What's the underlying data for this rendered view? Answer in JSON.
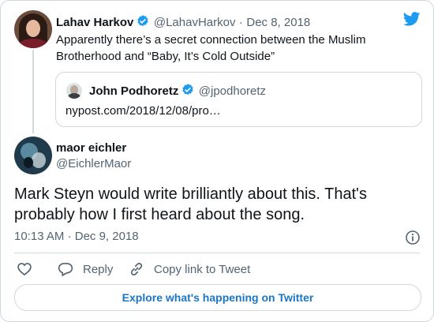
{
  "colors": {
    "accent": "#1d9bf0",
    "link": "#1d76c2",
    "secondary": "#536471",
    "border": "#cfd9de"
  },
  "parent_tweet": {
    "name": "Lahav Harkov",
    "handle": "@LahavHarkov",
    "separator": "·",
    "date": "Dec 8, 2018",
    "text": "Apparently there’s a secret connection between the Muslim Brotherhood and “Baby, It’s Cold Outside”",
    "verified_icon": "verified-badge-icon",
    "quoted": {
      "name": "John Podhoretz",
      "handle": "@jpodhoretz",
      "link": "nypost.com/2018/12/08/pro…"
    }
  },
  "reply_tweet": {
    "name": "maor eichler",
    "handle": "@EichlerMaor",
    "text": "Mark Steyn would write brilliantly about this. That's probably how I first heard about the song.",
    "time": "10:13 AM",
    "separator": "·",
    "date": "Dec 9, 2018"
  },
  "actions": {
    "like_icon": "heart-icon",
    "reply_label": "Reply",
    "reply_icon": "speech-bubble-icon",
    "copy_label": "Copy link to Tweet",
    "copy_icon": "link-icon"
  },
  "footer": {
    "explore_label": "Explore what's happening on Twitter"
  },
  "brand_icon": "twitter-bird-icon",
  "info_icon": "info-icon"
}
